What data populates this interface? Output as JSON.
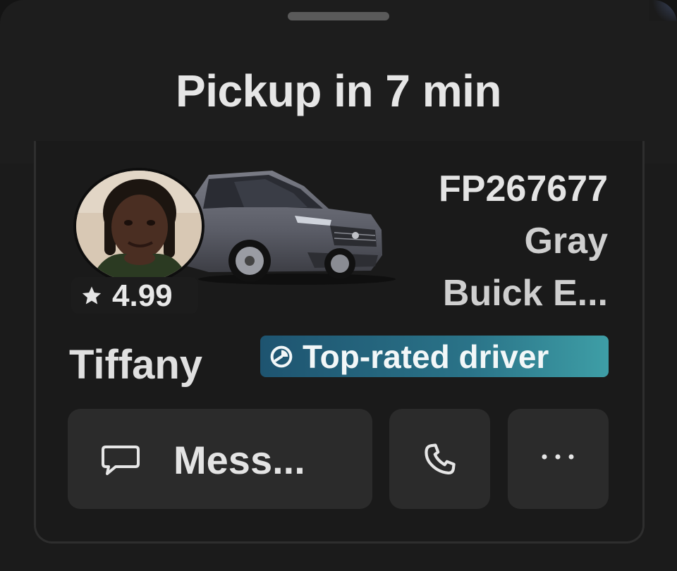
{
  "header": {
    "title": "Pickup in 7 min"
  },
  "driver": {
    "name": "Tiffany",
    "rating": "4.99",
    "badge": "Top-rated driver",
    "avatar_icon": "driver-avatar"
  },
  "vehicle": {
    "plate": "FP267677",
    "color": "Gray",
    "model": "Buick E...",
    "image_icon": "car-image"
  },
  "actions": {
    "message_label": "Mess...",
    "message_icon": "chat-bubble-icon",
    "call_icon": "phone-icon",
    "more_icon": "ellipsis-icon"
  },
  "colors": {
    "background": "#1b1b1b",
    "button": "#2b2b2b",
    "badge_start": "#1e5470",
    "badge_end": "#3e9ea6",
    "text": "#e4e4e4"
  }
}
